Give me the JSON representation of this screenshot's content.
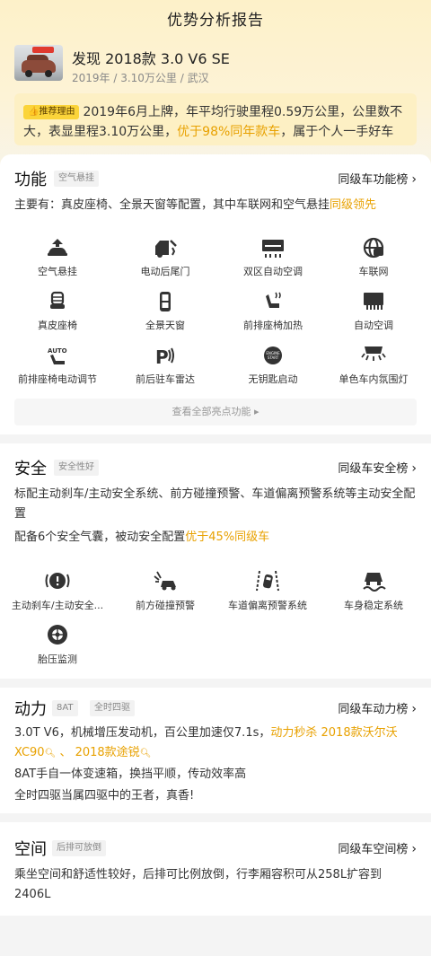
{
  "header": {
    "title": "优势分析报告"
  },
  "car": {
    "name": "发现 2018款 3.0 V6 SE",
    "meta": "2019年 / 3.10万公里 / 武汉"
  },
  "reason": {
    "tag": "推荐理由",
    "text_before": "2019年6月上牌，年平均行驶里程0.59万公里，公里数不大，表显里程3.10万公里，",
    "highlight": "优于98%同年款车",
    "text_after": "，属于个人一手好车"
  },
  "features": {
    "title": "功能",
    "tag": "空气悬挂",
    "rank_link": "同级车功能榜",
    "summary_before": "主要有：真皮座椅、全景天窗等配置，其中车联网和空气悬挂",
    "summary_highlight": "同级领先",
    "items": [
      {
        "label": "空气悬挂",
        "icon": "air-suspension-icon"
      },
      {
        "label": "电动后尾门",
        "icon": "power-tailgate-icon"
      },
      {
        "label": "双区自动空调",
        "icon": "dual-zone-ac-icon"
      },
      {
        "label": "车联网",
        "icon": "connected-car-icon"
      },
      {
        "label": "真皮座椅",
        "icon": "leather-seat-icon"
      },
      {
        "label": "全景天窗",
        "icon": "panoramic-sunroof-icon"
      },
      {
        "label": "前排座椅加热",
        "icon": "seat-heating-icon"
      },
      {
        "label": "自动空调",
        "icon": "auto-ac-icon"
      },
      {
        "label": "前排座椅电动调节",
        "icon": "power-seat-icon"
      },
      {
        "label": "前后驻车雷达",
        "icon": "parking-radar-icon"
      },
      {
        "label": "无钥匙启动",
        "icon": "keyless-start-icon"
      },
      {
        "label": "单色车内氛围灯",
        "icon": "ambient-light-icon"
      }
    ],
    "view_all": "查看全部亮点功能"
  },
  "safety": {
    "title": "安全",
    "tag": "安全性好",
    "rank_link": "同级车安全榜",
    "line1": "标配主动刹车/主动安全系统、前方碰撞预警、车道偏离预警系统等主动安全配置",
    "line2_before": "配备6个安全气囊，被动安全配置",
    "line2_highlight": "优于45%同级车",
    "items": [
      {
        "label": "主动刹车/主动安全...",
        "icon": "active-brake-icon"
      },
      {
        "label": "前方碰撞预警",
        "icon": "collision-warning-icon"
      },
      {
        "label": "车道偏离预警系统",
        "icon": "lane-departure-icon"
      },
      {
        "label": "车身稳定系统",
        "icon": "stability-control-icon"
      },
      {
        "label": "胎压监测",
        "icon": "tire-pressure-icon"
      }
    ]
  },
  "power": {
    "title": "动力",
    "tag1": "8AT",
    "tag2": "全时四驱",
    "rank_link": "同级车动力榜",
    "line1_before": "3.0T V6，机械增压发动机，百公里加速仅7.1s，",
    "line1_highlight": "动力秒杀",
    "compare1": "2018款沃尔沃XC90",
    "separator": "、",
    "compare2": "2018款途锐",
    "line2": "8AT手自一体变速箱，换挡平顺，传动效率高",
    "line3": "全时四驱当属四驱中的王者，真香!"
  },
  "space": {
    "title": "空间",
    "tag": "后排可放倒",
    "rank_link": "同级车空间榜",
    "text": "乘坐空间和舒适性较好，后排可比例放倒，行李厢容积可从258L扩容到2406L"
  },
  "colors": {
    "accent": "#e8a100",
    "reason_bg": "#fdf0c4",
    "tag_yellow": "#fbd43a"
  }
}
